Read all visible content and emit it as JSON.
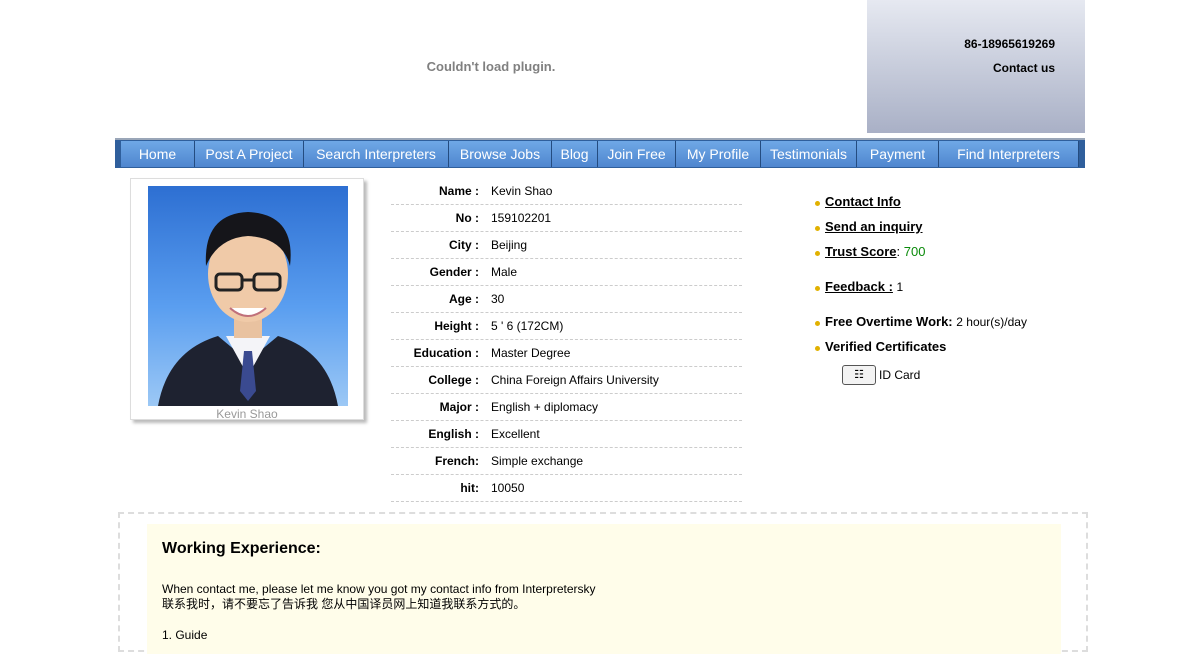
{
  "header": {
    "plugin_message": "Couldn't load plugin.",
    "phone": "86-18965619269",
    "contact_link": "Contact us"
  },
  "nav": [
    {
      "label": "Home",
      "width": 74
    },
    {
      "label": "Post A Project",
      "width": 109
    },
    {
      "label": "Search Interpreters",
      "width": 145
    },
    {
      "label": "Browse Jobs",
      "width": 103
    },
    {
      "label": "Blog",
      "width": 46
    },
    {
      "label": "Join Free",
      "width": 78
    },
    {
      "label": "My Profile",
      "width": 85
    },
    {
      "label": "Testimonials",
      "width": 96
    },
    {
      "label": "Payment",
      "width": 82
    },
    {
      "label": "Find Interpreters",
      "width": 140
    }
  ],
  "profile": {
    "caption": "Kevin Shao",
    "fields": [
      {
        "label": "Name :",
        "value": "Kevin Shao"
      },
      {
        "label": "No :",
        "value": "159102201"
      },
      {
        "label": "City :",
        "value": "Beijing"
      },
      {
        "label": "Gender :",
        "value": "Male"
      },
      {
        "label": "Age :",
        "value": "30"
      },
      {
        "label": "Height :",
        "value": "5 ' 6 (172CM)"
      },
      {
        "label": "Education :",
        "value": "Master Degree"
      },
      {
        "label": "College :",
        "value": "China Foreign Affairs University"
      },
      {
        "label": "Major :",
        "value": "English + diplomacy"
      },
      {
        "label": "English :",
        "value": "Excellent"
      },
      {
        "label": "French:",
        "value": "Simple exchange"
      },
      {
        "label": "hit:",
        "value": "10050"
      }
    ]
  },
  "side": {
    "contact_info": "Contact Info",
    "send_inquiry": "Send an inquiry",
    "trust_score_label": "Trust Score",
    "trust_score_sep": ":",
    "trust_score_value": "700",
    "feedback_label": "Feedback :",
    "feedback_value": "1",
    "overtime_label": "Free Overtime Work:",
    "overtime_value": "2 hour(s)/day",
    "verified_label": "Verified Certificates",
    "id_card": "ID Card"
  },
  "experience": {
    "title": "Working Experience:",
    "line1": "When contact me, please let me know you got my contact info from Interpretersky",
    "line2": "联系我时，请不要忘了告诉我 您从中国译员网上知道我联系方式的。",
    "list_start": "1. Guide"
  },
  "colors": {
    "nav_bg": "#4f86cf",
    "trust_score": "#0a8a0a",
    "exp_bg": "#fffdea"
  }
}
